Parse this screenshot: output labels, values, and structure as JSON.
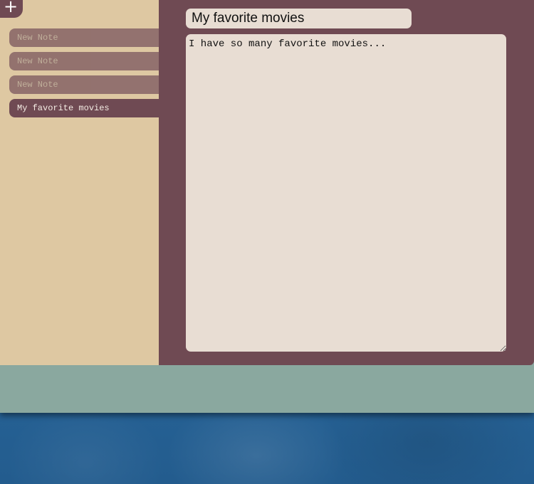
{
  "toolbar": {
    "add_label": "+"
  },
  "notes": [
    {
      "title": "New Note",
      "active": false
    },
    {
      "title": "New Note",
      "active": false
    },
    {
      "title": "New Note",
      "active": false
    },
    {
      "title": "My favorite movies",
      "active": true
    }
  ],
  "editor": {
    "title_value": "My favorite movies",
    "body_value": "I have so many favorite movies..."
  },
  "colors": {
    "sidebar_bg": "#dec8a2",
    "editor_bg": "#6f4a53",
    "field_bg": "#e8ddd3",
    "footer_bg": "#8aa89f",
    "desktop_bg": "#2a6a9e"
  }
}
